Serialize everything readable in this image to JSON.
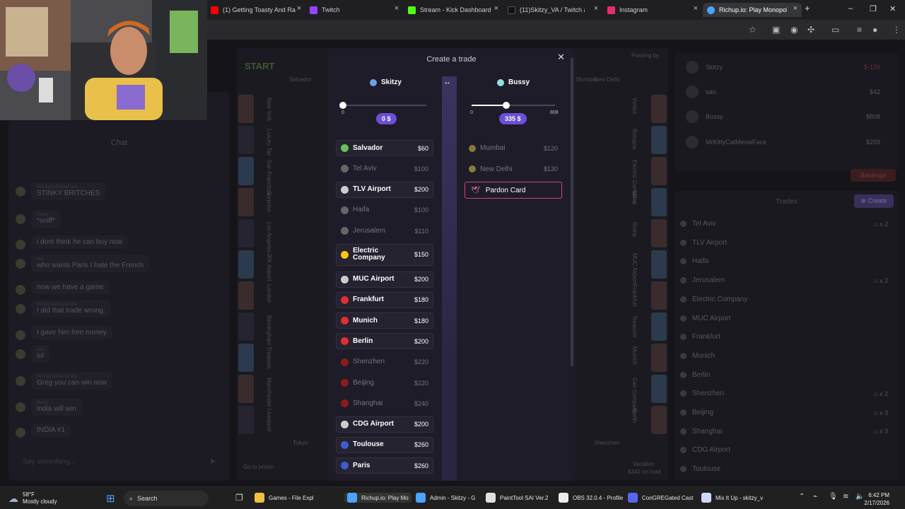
{
  "browser": {
    "tabs": [
      {
        "label": "(1) Getting Toasty And Ra",
        "color": "#ff0000"
      },
      {
        "label": "Twitch",
        "color": "#9146ff"
      },
      {
        "label": "Stream - Kick Dashboard",
        "color": "#53fc18"
      },
      {
        "label": "(11)Skitzy_VA / Twitch and",
        "color": "#111111"
      },
      {
        "label": "Instagram",
        "color": "#e1306c"
      },
      {
        "label": "Richup.io: Play Monopoly",
        "color": "#4aa3ff"
      }
    ],
    "active_tab": 5
  },
  "chat": {
    "title": "Chat",
    "messages": [
      {
        "user": "MrKittyCatMeowFace",
        "text": "STINKY BRITCHES"
      },
      {
        "user": "Bussy",
        "text": "*sniff*"
      },
      {
        "user": "",
        "text": "i dont think he can buy now"
      },
      {
        "user": "tato",
        "text": "who wants Paris I hate the French"
      },
      {
        "user": "",
        "text": "now we have a game"
      },
      {
        "user": "MrKittyCatMeowFace",
        "text": "I did that trade wrong."
      },
      {
        "user": "",
        "text": "I gave him free money"
      },
      {
        "user": "tato",
        "text": "lol"
      },
      {
        "user": "MrKittyCatMeowFace",
        "text": "Greg you can win now"
      },
      {
        "user": "Bussy",
        "text": "india will win"
      },
      {
        "user": "",
        "text": "INDIA #1"
      }
    ],
    "input_placeholder": "Say something..."
  },
  "board": {
    "start_label": "START",
    "left_labels": [
      "New York",
      "Luxury Tax",
      "San Francisco",
      "Surprise",
      "Los Angeles",
      "JFK Airport",
      "London",
      "Birmingham",
      "Treasure",
      "Manchester",
      "Liverpool"
    ],
    "right_labels": [
      "Venice",
      "Bologna",
      "Electric Company",
      "Milan",
      "Rome",
      "MUC Airport",
      "Frankfurt",
      "Treasure",
      "Munich",
      "Gas Company",
      "Berlin"
    ],
    "bottom_labels": [
      "Go to prison",
      "Tokyo",
      "Shenzhen",
      "Vacation"
    ],
    "vacation_sub": "$341 on hold",
    "top_labels": [
      "Salvador",
      "Passing by",
      "Mumbai",
      "New Delhi"
    ]
  },
  "players": [
    {
      "name": "Skitzy",
      "money": "$-139"
    },
    {
      "name": "tato",
      "money": "$42"
    },
    {
      "name": "Bussy",
      "money": "$808"
    },
    {
      "name": "MrKittyCatMeowFace",
      "money": "$259"
    }
  ],
  "bankrupt_label": "Bankrupt",
  "trades": {
    "title": "Trades",
    "create_label": "Create",
    "properties": [
      {
        "name": "Tel Aviv",
        "houses": "x 2"
      },
      {
        "name": "TLV Airport",
        "houses": ""
      },
      {
        "name": "Haifa",
        "houses": ""
      },
      {
        "name": "Jerusalem",
        "houses": "x 2"
      },
      {
        "name": "Electric Company",
        "houses": ""
      },
      {
        "name": "MUC Airport",
        "houses": ""
      },
      {
        "name": "Frankfurt",
        "houses": ""
      },
      {
        "name": "Munich",
        "houses": ""
      },
      {
        "name": "Berlin",
        "houses": ""
      },
      {
        "name": "Shenzhen",
        "houses": "x 2"
      },
      {
        "name": "Beijing",
        "houses": "x 3"
      },
      {
        "name": "Shanghai",
        "houses": "x 3"
      },
      {
        "name": "CDG Airport",
        "houses": ""
      },
      {
        "name": "Toulouse",
        "houses": ""
      }
    ]
  },
  "trade": {
    "title": "Create a trade",
    "left": {
      "name": "Skitzy",
      "slider_min": "0",
      "slider_value": 0,
      "slider_max": 0,
      "money_label": "0 $",
      "properties": [
        {
          "name": "Salvador",
          "price": "$60",
          "owned": true,
          "icon": "#6abf5b"
        },
        {
          "name": "Tel Aviv",
          "price": "$100",
          "owned": false,
          "icon": "#666"
        },
        {
          "name": "TLV Airport",
          "price": "$200",
          "owned": true,
          "icon": "#ccc"
        },
        {
          "name": "Haifa",
          "price": "$100",
          "owned": false,
          "icon": "#666"
        },
        {
          "name": "Jerusalem",
          "price": "$110",
          "owned": false,
          "icon": "#666"
        },
        {
          "name": "Electric Company",
          "price": "$150",
          "owned": true,
          "icon": "#f5c518"
        },
        {
          "name": "MUC Airport",
          "price": "$200",
          "owned": true,
          "icon": "#ccc"
        },
        {
          "name": "Frankfurt",
          "price": "$180",
          "owned": true,
          "icon": "#dd3030"
        },
        {
          "name": "Munich",
          "price": "$180",
          "owned": true,
          "icon": "#dd3030"
        },
        {
          "name": "Berlin",
          "price": "$200",
          "owned": true,
          "icon": "#dd3030"
        },
        {
          "name": "Shenzhen",
          "price": "$220",
          "owned": false,
          "icon": "#8a1c1c"
        },
        {
          "name": "Beijing",
          "price": "$220",
          "owned": false,
          "icon": "#8a1c1c"
        },
        {
          "name": "Shanghai",
          "price": "$240",
          "owned": false,
          "icon": "#8a1c1c"
        },
        {
          "name": "CDG Airport",
          "price": "$200",
          "owned": true,
          "icon": "#ccc"
        },
        {
          "name": "Toulouse",
          "price": "$260",
          "owned": true,
          "icon": "#3d5ccf"
        },
        {
          "name": "Paris",
          "price": "$260",
          "owned": true,
          "icon": "#3d5ccf"
        }
      ]
    },
    "right": {
      "name": "Bussy",
      "slider_min": "0",
      "slider_max_label": "808",
      "slider_value": 335,
      "slider_max": 808,
      "money_label": "335 $",
      "properties": [
        {
          "name": "Mumbai",
          "price": "$120"
        },
        {
          "name": "New Delhi",
          "price": "$130"
        }
      ],
      "pardon_label": "Pardon Card"
    },
    "accent": "#6c4fd6"
  },
  "taskbar": {
    "weather_temp": "58°F",
    "weather_desc": "Mostly cloudy",
    "search_label": "Search",
    "apps": [
      {
        "label": "Games - File Expl",
        "color": "#f0c040"
      },
      {
        "label": "Richup.io: Play Mo",
        "color": "#4aa3ff"
      },
      {
        "label": "Admin - Skitzy - G",
        "color": "#4aa3ff"
      },
      {
        "label": "PaintTool SAI Ver.2",
        "color": "#e0e0e0"
      },
      {
        "label": "OBS 32.0.4 - Profile",
        "color": "#eeeeee"
      },
      {
        "label": "ConGREGated Cast",
        "color": "#5865f2"
      },
      {
        "label": "Mix It Up - skitzy_v",
        "color": "#cfd8ff"
      }
    ],
    "time": "6:42 PM",
    "date": "2/17/2026"
  }
}
